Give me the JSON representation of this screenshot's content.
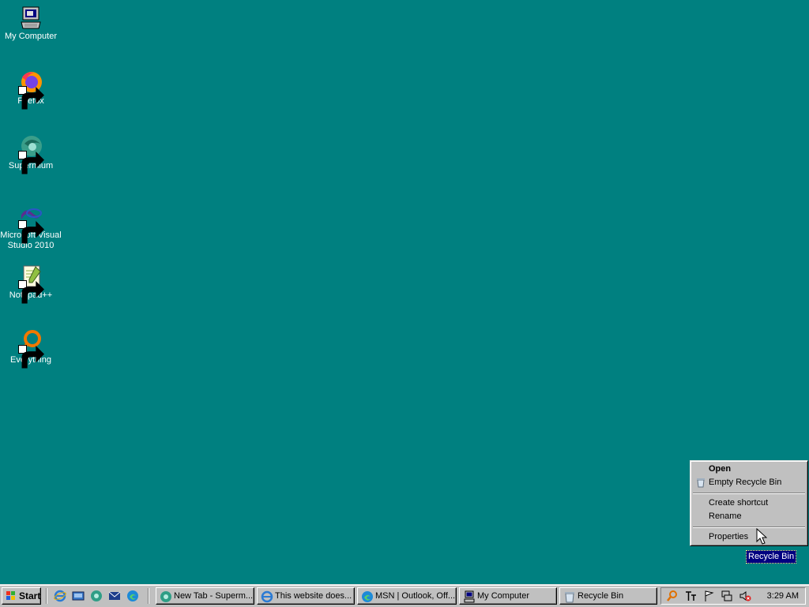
{
  "desktop": {
    "icons": [
      {
        "label": "My Computer",
        "icon": "my-computer-icon"
      },
      {
        "label": "Firefox",
        "icon": "firefox-icon"
      },
      {
        "label": "Supermium",
        "icon": "supermium-icon"
      },
      {
        "label": "Microsoft Visual Studio 2010",
        "icon": "visual-studio-icon"
      },
      {
        "label": "Notepad++",
        "icon": "notepadpp-icon"
      },
      {
        "label": "Everything",
        "icon": "everything-icon"
      }
    ],
    "background": "#008080"
  },
  "context_menu": {
    "items": [
      {
        "label": "Open",
        "default": true
      },
      {
        "label": "Empty Recycle Bin",
        "icon": "recycle-bin-icon"
      },
      {
        "label": "Create shortcut"
      },
      {
        "label": "Rename"
      },
      {
        "label": "Properties"
      }
    ]
  },
  "selected_icon_label": "Recycle Bin",
  "taskbar": {
    "start_label": "Start",
    "quick_launch": [
      "internet-explorer-icon",
      "show-desktop-icon",
      "supermium-icon",
      "outlook-icon",
      "edge-icon"
    ],
    "buttons": [
      {
        "label": "New Tab - Superm...",
        "icon": "supermium-icon"
      },
      {
        "label": "This website does...",
        "icon": "internet-explorer-icon"
      },
      {
        "label": "MSN | Outlook, Off...",
        "icon": "edge-icon"
      },
      {
        "label": "My Computer",
        "icon": "my-computer-icon"
      },
      {
        "label": "Recycle Bin",
        "icon": "recycle-bin-icon"
      }
    ],
    "tray_icons": [
      "search-icon",
      "ime-icon",
      "flag-icon",
      "network-icon",
      "volume-muted-icon"
    ],
    "clock": "3:29 AM"
  }
}
